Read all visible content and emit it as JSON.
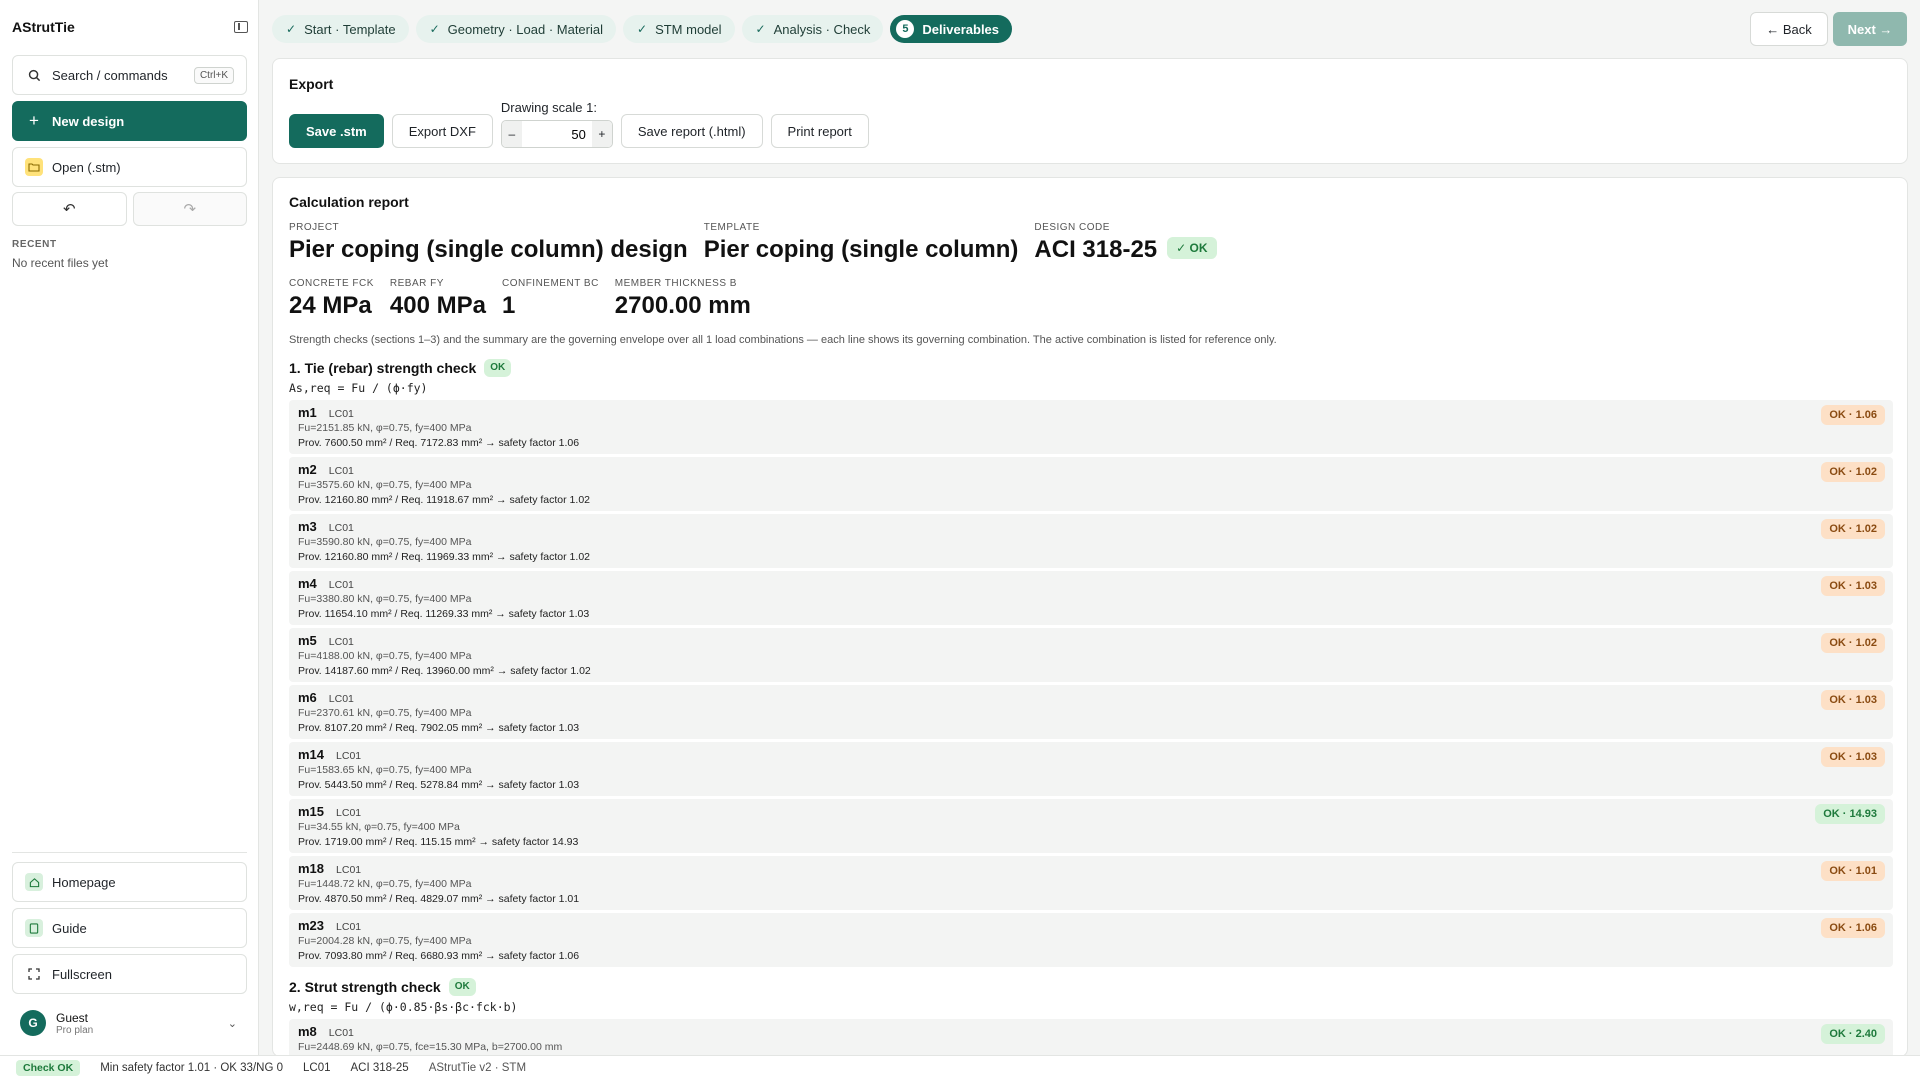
{
  "app": {
    "name": "AStrutTie"
  },
  "sidebar": {
    "search_label": "Search / commands",
    "search_kbd": "Ctrl+K",
    "new_label": "New design",
    "open_label": "Open (.stm)",
    "recent_title": "RECENT",
    "recent_empty": "No recent files yet",
    "homepage_label": "Homepage",
    "guide_label": "Guide",
    "fullscreen_label": "Fullscreen",
    "user": {
      "initial": "G",
      "name": "Guest",
      "plan": "Pro plan"
    }
  },
  "steps": [
    {
      "label": "Start · Template"
    },
    {
      "label": "Geometry · Load · Material"
    },
    {
      "label": "STM model"
    },
    {
      "label": "Analysis · Check"
    },
    {
      "label": "Deliverables",
      "num": "5"
    }
  ],
  "nav": {
    "back": "← Back",
    "next": "Next →"
  },
  "export": {
    "title": "Export",
    "save_stm": "Save .stm",
    "export_dxf": "Export DXF",
    "scale_label": "Drawing scale 1:",
    "scale_value": "50",
    "save_report": "Save report (.html)",
    "print_report": "Print report"
  },
  "report": {
    "title": "Calculation report",
    "meta": {
      "project_label": "PROJECT",
      "project": "Pier coping (single column) design",
      "template_label": "TEMPLATE",
      "template": "Pier coping (single column)",
      "code_label": "DESIGN CODE",
      "code": "ACI 318-25",
      "code_status": "✓ OK",
      "fck_label": "CONCRETE FCK",
      "fck": "24 MPa",
      "fy_label": "REBAR FY",
      "fy": "400 MPa",
      "bc_label": "CONFINEMENT BC",
      "bc": "1",
      "b_label": "MEMBER THICKNESS B",
      "b": "2700.00 mm"
    },
    "note": "Strength checks (sections 1–3) and the summary are the governing envelope over all 1 load combinations — each line shows its governing combination. The active combination is listed for reference only.",
    "section1": {
      "title": "1. Tie (rebar) strength check",
      "status": "OK",
      "formula": "As,req = Fu / (ϕ·fy)",
      "rows": [
        {
          "member": "m1",
          "lc": "LC01",
          "params": "Fu=2151.85 kN, φ=0.75, fy=400 MPa",
          "result": "Prov. 7600.50 mm² / Req. 7172.83 mm² → safety factor 1.06",
          "badge": "OK · 1.06",
          "level": "warn"
        },
        {
          "member": "m2",
          "lc": "LC01",
          "params": "Fu=3575.60 kN, φ=0.75, fy=400 MPa",
          "result": "Prov. 12160.80 mm² / Req. 11918.67 mm² → safety factor 1.02",
          "badge": "OK · 1.02",
          "level": "warn"
        },
        {
          "member": "m3",
          "lc": "LC01",
          "params": "Fu=3590.80 kN, φ=0.75, fy=400 MPa",
          "result": "Prov. 12160.80 mm² / Req. 11969.33 mm² → safety factor 1.02",
          "badge": "OK · 1.02",
          "level": "warn"
        },
        {
          "member": "m4",
          "lc": "LC01",
          "params": "Fu=3380.80 kN, φ=0.75, fy=400 MPa",
          "result": "Prov. 11654.10 mm² / Req. 11269.33 mm² → safety factor 1.03",
          "badge": "OK · 1.03",
          "level": "warn"
        },
        {
          "member": "m5",
          "lc": "LC01",
          "params": "Fu=4188.00 kN, φ=0.75, fy=400 MPa",
          "result": "Prov. 14187.60 mm² / Req. 13960.00 mm² → safety factor 1.02",
          "badge": "OK · 1.02",
          "level": "warn"
        },
        {
          "member": "m6",
          "lc": "LC01",
          "params": "Fu=2370.61 kN, φ=0.75, fy=400 MPa",
          "result": "Prov. 8107.20 mm² / Req. 7902.05 mm² → safety factor 1.03",
          "badge": "OK · 1.03",
          "level": "warn"
        },
        {
          "member": "m14",
          "lc": "LC01",
          "params": "Fu=1583.65 kN, φ=0.75, fy=400 MPa",
          "result": "Prov. 5443.50 mm² / Req. 5278.84 mm² → safety factor 1.03",
          "badge": "OK · 1.03",
          "level": "warn"
        },
        {
          "member": "m15",
          "lc": "LC01",
          "params": "Fu=34.55 kN, φ=0.75, fy=400 MPa",
          "result": "Prov. 1719.00 mm² / Req. 115.15 mm² → safety factor 14.93",
          "badge": "OK · 14.93",
          "level": "ok"
        },
        {
          "member": "m18",
          "lc": "LC01",
          "params": "Fu=1448.72 kN, φ=0.75, fy=400 MPa",
          "result": "Prov. 4870.50 mm² / Req. 4829.07 mm² → safety factor 1.01",
          "badge": "OK · 1.01",
          "level": "warn"
        },
        {
          "member": "m23",
          "lc": "LC01",
          "params": "Fu=2004.28 kN, φ=0.75, fy=400 MPa",
          "result": "Prov. 7093.80 mm² / Req. 6680.93 mm² → safety factor 1.06",
          "badge": "OK · 1.06",
          "level": "warn"
        }
      ]
    },
    "section2": {
      "title": "2. Strut strength check",
      "status": "OK",
      "formula": "w,req = Fu / (ϕ·0.85·βs·βc·fck·b)",
      "rows": [
        {
          "member": "m8",
          "lc": "LC01",
          "params": "Fu=2448.69 kN, φ=0.75, fce=15.30 MPa, b=2700.00 mm",
          "result": "",
          "badge": "OK · 2.40",
          "level": "ok"
        }
      ]
    }
  },
  "statusbar": {
    "check": "Check OK",
    "summary": "Min safety factor 1.01 · OK 33/NG 0",
    "lc": "LC01",
    "code": "ACI 318-25",
    "version": "AStrutTie v2 · STM"
  }
}
